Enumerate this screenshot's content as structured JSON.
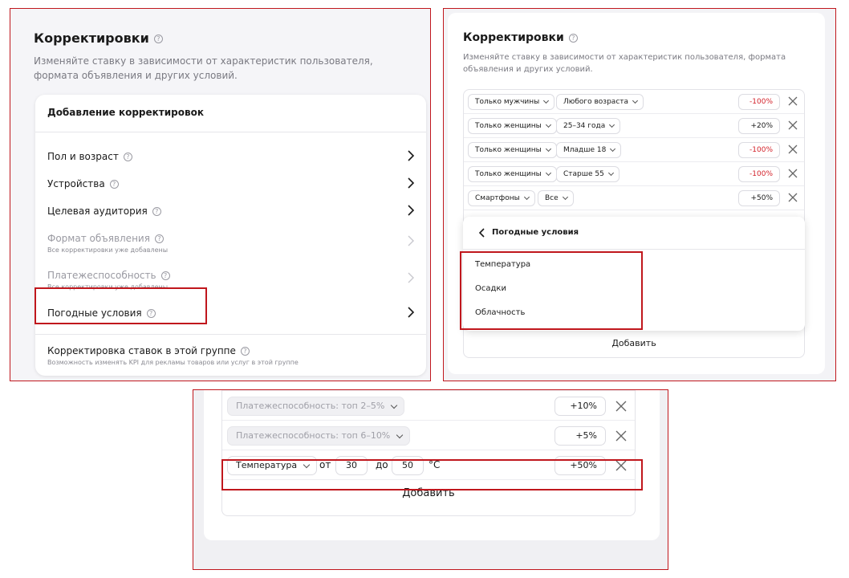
{
  "panel1": {
    "title": "Корректировки",
    "description": "Изменяйте ставку в зависимости от характеристик пользователя, формата объявления и других условий.",
    "card_title": "Добавление корректировок",
    "items": [
      {
        "label": "Пол и возраст",
        "sub": ""
      },
      {
        "label": "Устройства",
        "sub": ""
      },
      {
        "label": "Целевая аудитория",
        "sub": ""
      },
      {
        "label": "Формат объявления",
        "sub": "Все корректировки уже добавлены"
      },
      {
        "label": "Платежеспособность",
        "sub": "Все корректировки уже добавлены"
      },
      {
        "label": "Погодные условия",
        "sub": ""
      }
    ],
    "group_title": "Корректировка ставок в этой группе",
    "group_sub": "Возможность изменять KPI для рекламы товаров или услуг в этой группе"
  },
  "panel2": {
    "title": "Корректировки",
    "description": "Изменяйте ставку в зависимости от характеристик пользователя, формата объявления и других условий.",
    "rows": [
      {
        "a": "Только мужчины",
        "b": "Любого возраста",
        "pct": "-100%"
      },
      {
        "a": "Только женщины",
        "b": "25–34 года",
        "pct": "+20%"
      },
      {
        "a": "Только женщины",
        "b": "Младше 18",
        "pct": "-100%"
      },
      {
        "a": "Только женщины",
        "b": "Старше 55",
        "pct": "-100%"
      },
      {
        "a": "Смартфоны",
        "b": "Все",
        "pct": "+50%"
      }
    ],
    "dropdown_title": "Погодные условия",
    "dropdown_items": [
      "Температура",
      "Осадки",
      "Облачность"
    ],
    "add_label": "Добавить"
  },
  "panel3": {
    "rows": [
      {
        "label": "Платежеспособность: топ 2–5%",
        "pct": "+10%"
      },
      {
        "label": "Платежеспособность: топ 6–10%",
        "pct": "+5%"
      }
    ],
    "temp": {
      "select": "Температура",
      "from_label": "от",
      "from_value": "30",
      "to_label": "до",
      "to_value": "50",
      "unit": "°C",
      "pct": "+50%"
    },
    "add_label": "Добавить"
  },
  "colors": {
    "frame": "#c0171d",
    "negative": "#d3212a"
  }
}
